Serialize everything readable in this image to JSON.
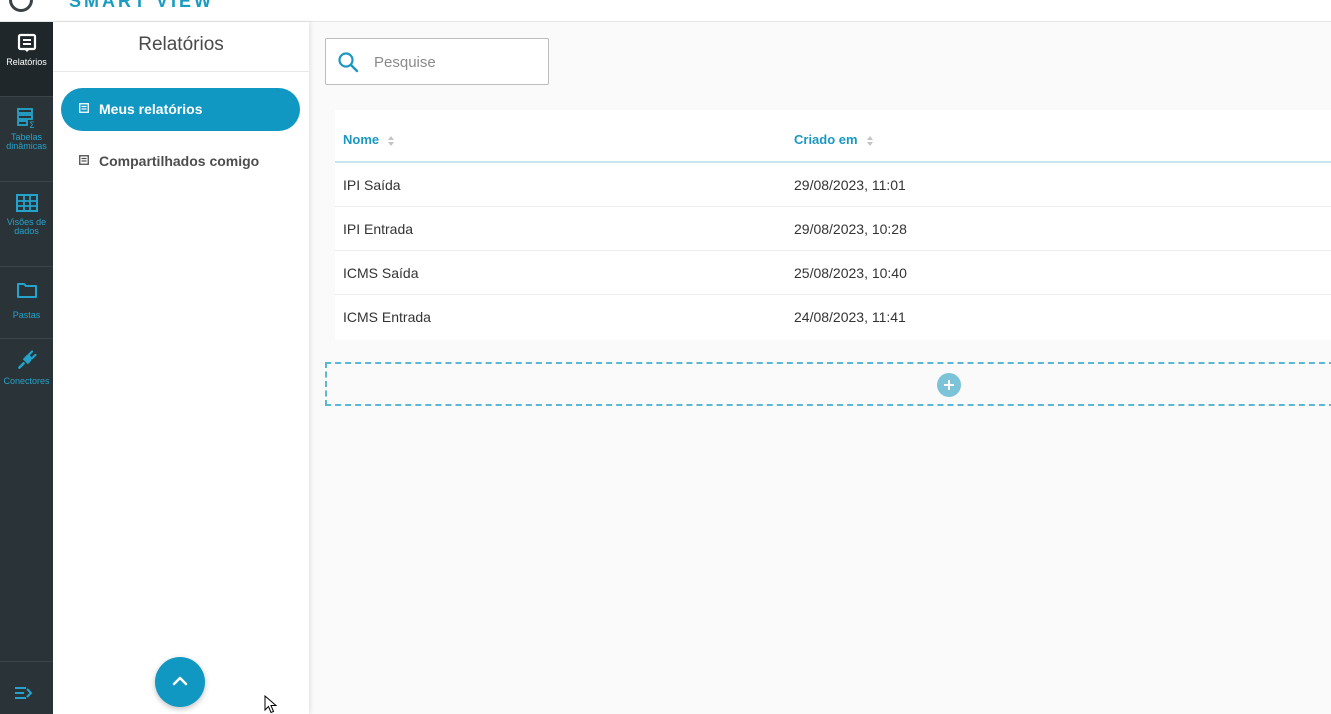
{
  "app": {
    "title": "SMART VIEW"
  },
  "rail": {
    "items": [
      {
        "label": "Relatórios",
        "icon": "report-icon"
      },
      {
        "label": "Tabelas dinâmicas",
        "icon": "pivot-table-icon"
      },
      {
        "label": "Visões de dados",
        "icon": "table-grid-icon"
      },
      {
        "label": "Pastas",
        "icon": "folder-icon"
      },
      {
        "label": "Conectores",
        "icon": "plug-icon"
      }
    ],
    "collapse_icon": "expand-menu-icon"
  },
  "sidebar": {
    "title": "Relatórios",
    "items": [
      {
        "label": "Meus relatórios",
        "icon": "document-icon",
        "active": true
      },
      {
        "label": "Compartilhados comigo",
        "icon": "document-icon",
        "active": false
      }
    ],
    "scroll_top_icon": "chevron-up-icon"
  },
  "search": {
    "placeholder": "Pesquise",
    "value": "",
    "icon": "search-icon"
  },
  "table": {
    "columns": [
      {
        "label": "Nome",
        "sortable": true
      },
      {
        "label": "Criado em",
        "sortable": true
      }
    ],
    "rows": [
      {
        "name": "IPI Saída",
        "created": "29/08/2023, 11:01"
      },
      {
        "name": "IPI Entrada",
        "created": "29/08/2023, 10:28"
      },
      {
        "name": "ICMS Saída",
        "created": "25/08/2023, 10:40"
      },
      {
        "name": "ICMS Entrada",
        "created": "24/08/2023, 11:41"
      }
    ]
  },
  "add_report": {
    "icon": "plus-icon"
  },
  "colors": {
    "accent": "#1198c2",
    "rail_bg": "#2a3337",
    "rail_icon": "#24a4cc",
    "dropzone_border": "#5ab8d2"
  }
}
